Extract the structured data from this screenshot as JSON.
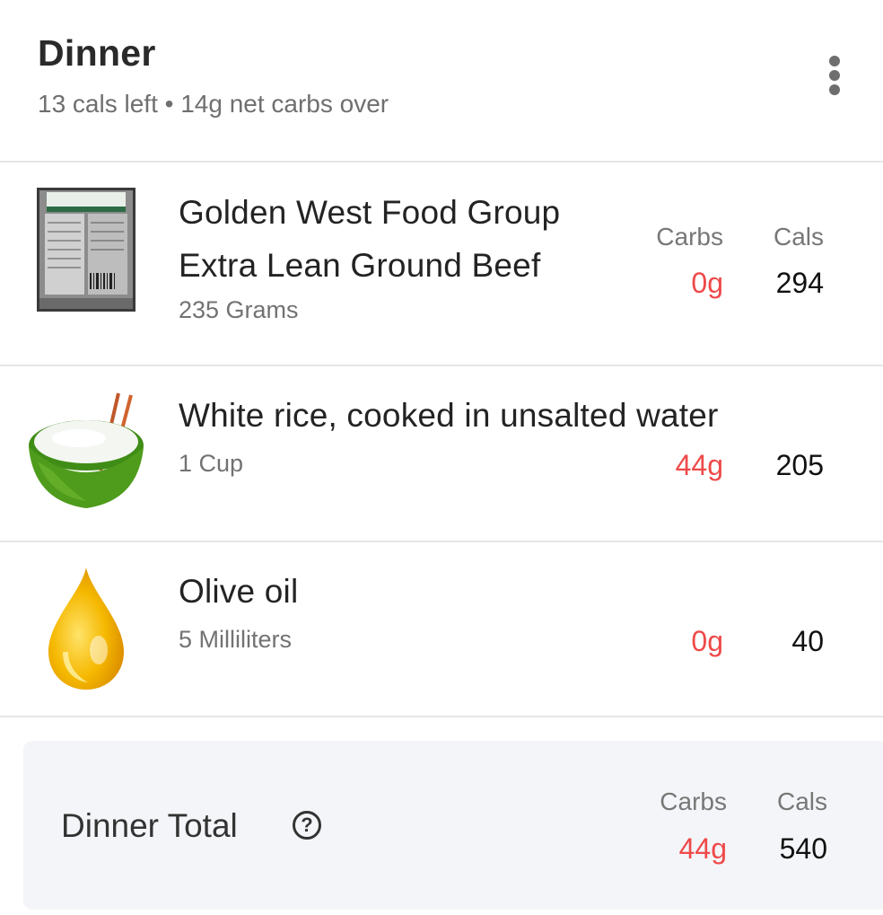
{
  "meal": {
    "title": "Dinner",
    "subtitle": "13 cals left • 14g net carbs over"
  },
  "columns": {
    "carbs_label": "Carbs",
    "cals_label": "Cals"
  },
  "foods": [
    {
      "name_line1": "Golden West Food Group",
      "name_line2": "Extra Lean Ground Beef",
      "serving": "235 Grams",
      "carbs": "0g",
      "cals": "294",
      "image": "ground-beef-package-icon"
    },
    {
      "name_line1": "White rice, cooked in unsalted water",
      "serving": "1 Cup",
      "carbs": "44g",
      "cals": "205",
      "image": "rice-bowl-icon"
    },
    {
      "name_line1": "Olive oil",
      "serving": "5 Milliliters",
      "carbs": "0g",
      "cals": "40",
      "image": "oil-drop-icon"
    }
  ],
  "total": {
    "label": "Dinner Total",
    "help_icon": "?",
    "carbs": "44g",
    "cals": "540"
  },
  "colors": {
    "carbs_accent": "#ee4a4a",
    "total_background": "#f4f5f8",
    "divider": "#e6e6e6"
  }
}
